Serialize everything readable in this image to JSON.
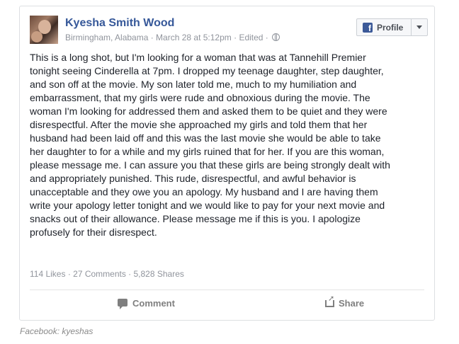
{
  "post": {
    "author": "Kyesha Smith Wood",
    "meta_text": "Birmingham, Alabama · March 28 at 5:12pm · Edited ·",
    "privacy_icon": "globe-icon",
    "profile_button": "Profile",
    "body": "This is a long shot, but I'm looking for a woman that was at Tannehill Premier\ntonight seeing Cinderella at 7pm. I dropped my teenage daughter, step daughter,\nand son off at the movie. My son later told me, much to my humiliation and\nembarrassment, that my girls were rude and obnoxious during the movie. The\nwoman I'm looking for addressed them and asked them to be quiet and they were\ndisrespectful. After the movie she approached my girls and told them that her\nhusband had been laid off and this was the last movie she would be able to take\nher daughter to for a while and my girls ruined that for her. If you are this woman,\nplease message me. I can assure you that these girls are being strongly dealt with\nand appropriately punished. This rude, disrespectful, and awful behavior is\nunacceptable and they owe you an apology. My husband and I are having them\nwrite your apology letter tonight and we would like to pay for your next movie and\nsnacks out of their allowance. Please message me if this is you. I apologize\nprofusely for their disrespect.",
    "stats": "114 Likes · 27 Comments · 5,828 Shares",
    "actions": {
      "comment": "Comment",
      "share": "Share"
    }
  },
  "caption": "Facebook: kyeshas",
  "colors": {
    "name": "#365899",
    "fb_blue": "#3b5998",
    "muted": "#90949c"
  }
}
